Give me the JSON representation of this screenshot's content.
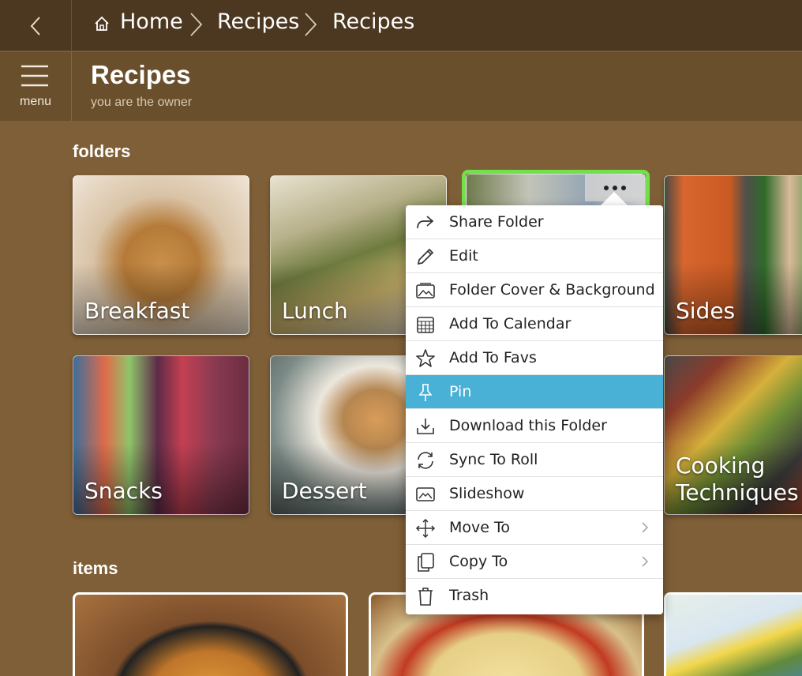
{
  "breadcrumb": {
    "home": "Home",
    "items": [
      "Recipes",
      "Recipes"
    ]
  },
  "header": {
    "menu_label": "menu",
    "title": "Recipes",
    "subtitle": "you are the owner"
  },
  "sections": {
    "folders": "folders",
    "items": "items"
  },
  "folders": [
    {
      "label": "Breakfast"
    },
    {
      "label": "Lunch"
    },
    {
      "label": ""
    },
    {
      "label": "Sides"
    },
    {
      "label": "Snacks"
    },
    {
      "label": "Dessert"
    },
    {
      "label": "Cooking Techniques Tips"
    }
  ],
  "folder_extra": {
    "cooking_line1": "Cooking",
    "cooking_line2": "Techniques Tip"
  },
  "context_menu": {
    "items": [
      {
        "label": "Share Folder",
        "icon": "share-icon"
      },
      {
        "label": "Edit",
        "icon": "pencil-icon"
      },
      {
        "label": "Folder Cover & Background",
        "icon": "image-icon"
      },
      {
        "label": "Add To Calendar",
        "icon": "calendar-icon"
      },
      {
        "label": "Add To Favs",
        "icon": "star-icon"
      },
      {
        "label": "Pin",
        "icon": "pin-icon",
        "highlighted": true
      },
      {
        "label": "Download this Folder",
        "icon": "download-icon"
      },
      {
        "label": "Sync To Roll",
        "icon": "sync-icon"
      },
      {
        "label": "Slideshow",
        "icon": "slideshow-icon"
      },
      {
        "label": "Move To",
        "icon": "move-icon",
        "submenu": true
      },
      {
        "label": "Copy To",
        "icon": "copy-icon",
        "submenu": true
      },
      {
        "label": "Trash",
        "icon": "trash-icon"
      }
    ]
  },
  "colors": {
    "background": "#7f5f37",
    "topbar": "#4c3720",
    "header": "#6a4f2c",
    "menu_highlight": "#4ab1d6",
    "selected_outline": "#72e04a"
  }
}
